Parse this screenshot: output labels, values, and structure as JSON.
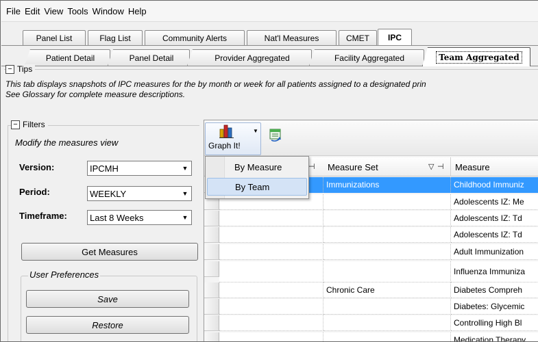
{
  "menubar": [
    "File",
    "Edit",
    "View",
    "Tools",
    "Window",
    "Help"
  ],
  "tabs_top": [
    {
      "label": "Panel List",
      "active": false
    },
    {
      "label": "Flag List",
      "active": false
    },
    {
      "label": "Community Alerts",
      "active": false
    },
    {
      "label": "Nat'l Measures",
      "active": false
    },
    {
      "label": "CMET",
      "active": false
    },
    {
      "label": "IPC",
      "active": true
    }
  ],
  "tabs_sub": [
    {
      "label": "Patient Detail",
      "active": false
    },
    {
      "label": "Panel Detail",
      "active": false
    },
    {
      "label": "Provider Aggregated",
      "active": false
    },
    {
      "label": "Facility Aggregated",
      "active": false
    },
    {
      "label": "Team Aggregated",
      "active": true
    }
  ],
  "tips": {
    "collapse_glyph": "−",
    "title": "Tips",
    "line1": "This tab displays snapshots of IPC measures for the by month or week for all patients assigned to a designated prin",
    "line2": "See Glossary for complete measure descriptions."
  },
  "filters": {
    "collapse_glyph": "−",
    "title": "Filters",
    "subtitle": "Modify the measures view",
    "version_label": "Version:",
    "version_value": "IPCMH",
    "period_label": "Period:",
    "period_value": "WEEKLY",
    "timeframe_label": "Timeframe:",
    "timeframe_value": "Last 8 Weeks",
    "get_measures": "Get Measures",
    "user_prefs_title": "User Preferences",
    "save": "Save",
    "restore": "Restore"
  },
  "toolbar": {
    "graph_label": "Graph It!",
    "graph_menu": [
      "By Measure",
      "By Team"
    ],
    "hovered_item": "By Team"
  },
  "grid": {
    "headers": [
      "Measure Set",
      "Measure"
    ],
    "rows": [
      {
        "set": "Immunizations",
        "measure": "Childhood Immuniz",
        "selected": true
      },
      {
        "set": "",
        "measure": "Adolescents IZ: Me",
        "selected": false
      },
      {
        "set": "",
        "measure": "Adolescents IZ: Td",
        "selected": false
      },
      {
        "set": "",
        "measure": "Adolescents IZ: Td",
        "selected": false
      },
      {
        "set": "",
        "measure": "Adult Immunization",
        "selected": false
      },
      {
        "set": "",
        "measure": "Influenza Immuniza",
        "selected": false
      },
      {
        "set": "Chronic Care",
        "measure": "Diabetes Compreh",
        "selected": false
      },
      {
        "set": "",
        "measure": "Diabetes: Glycemic",
        "selected": false
      },
      {
        "set": "",
        "measure": "Controlling High Bl",
        "selected": false
      },
      {
        "set": "",
        "measure": "Medication Therapy",
        "selected": false
      }
    ]
  },
  "colors": {
    "selection": "#3399ff",
    "menu_hover": "#d4e3f6"
  }
}
